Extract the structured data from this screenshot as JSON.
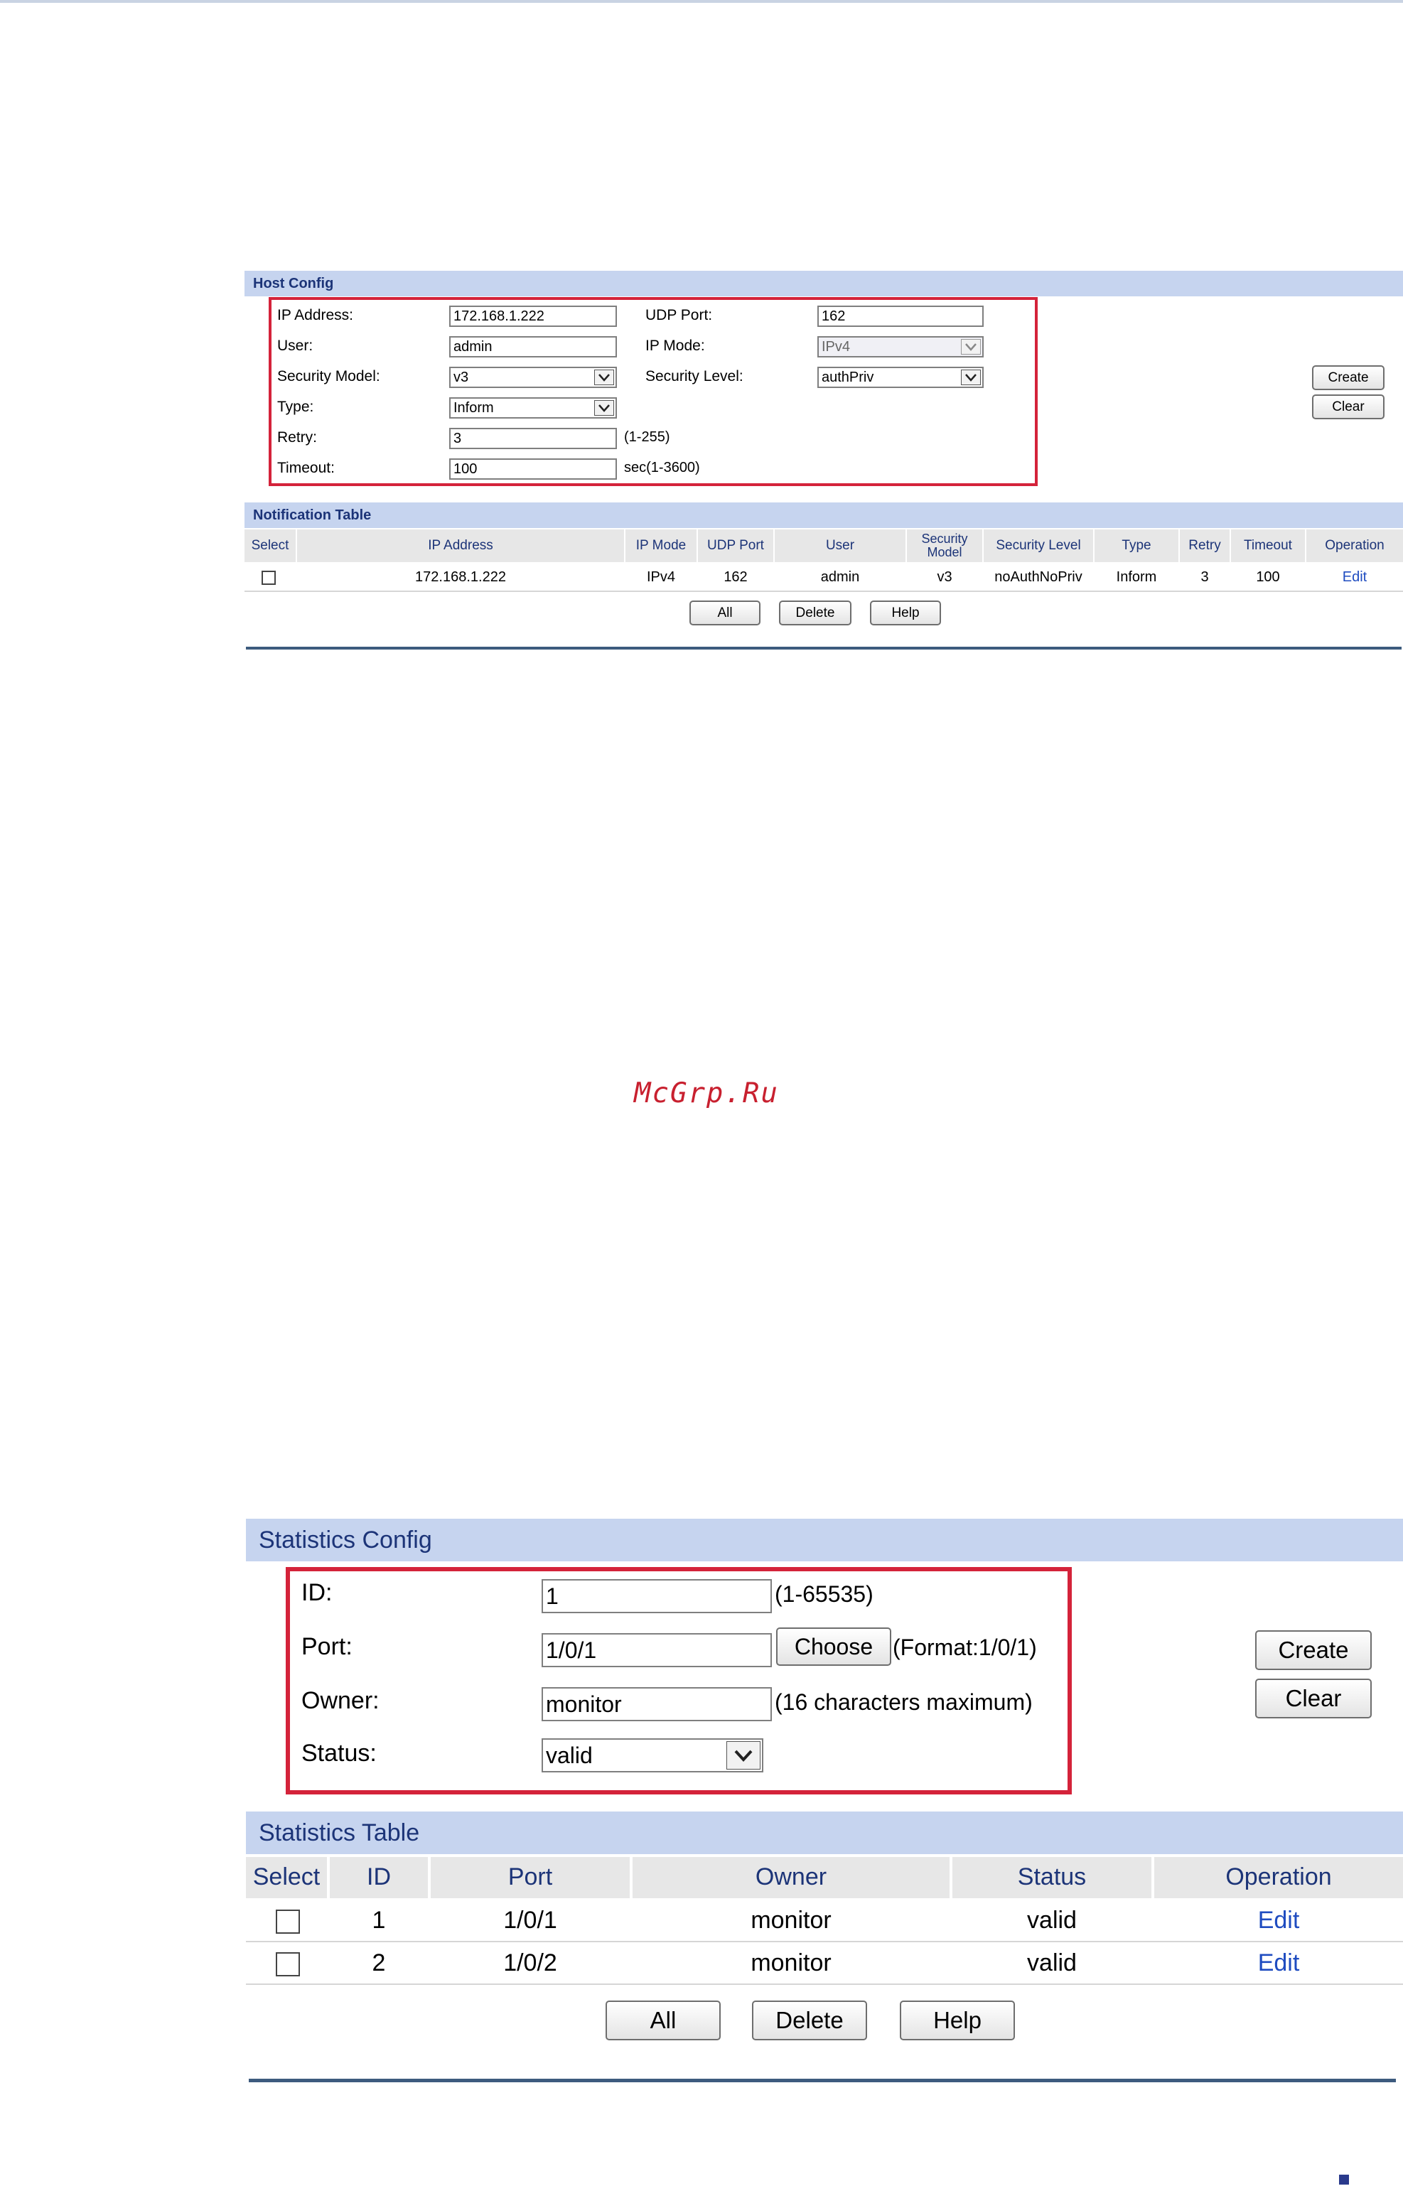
{
  "host_config": {
    "header": "Host Config",
    "fields": {
      "ip_address": {
        "label": "IP Address:",
        "value": "172.168.1.222"
      },
      "udp_port": {
        "label": "UDP Port:",
        "value": "162"
      },
      "user": {
        "label": "User:",
        "value": "admin"
      },
      "ip_mode": {
        "label": "IP Mode:",
        "value": "IPv4"
      },
      "security_model": {
        "label": "Security Model:",
        "value": "v3"
      },
      "security_level": {
        "label": "Security Level:",
        "value": "authPriv"
      },
      "type": {
        "label": "Type:",
        "value": "Inform"
      },
      "retry": {
        "label": "Retry:",
        "value": "3",
        "hint": "(1-255)"
      },
      "timeout": {
        "label": "Timeout:",
        "value": "100",
        "hint": "sec(1-3600)"
      }
    },
    "create_label": "Create",
    "clear_label": "Clear"
  },
  "notification_table": {
    "header": "Notification Table",
    "columns": [
      "Select",
      "IP Address",
      "IP Mode",
      "UDP Port",
      "User",
      "Security Model",
      "Security Level",
      "Type",
      "Retry",
      "Timeout",
      "Operation"
    ],
    "rows": [
      {
        "ip": "172.168.1.222",
        "ip_mode": "IPv4",
        "udp_port": "162",
        "user": "admin",
        "security_model": "v3",
        "security_level": "noAuthNoPriv",
        "type": "Inform",
        "retry": "3",
        "timeout": "100",
        "operation": "Edit"
      }
    ],
    "all_label": "All",
    "delete_label": "Delete",
    "help_label": "Help"
  },
  "watermark": "McGrp.Ru",
  "statistics_config": {
    "header": "Statistics Config",
    "fields": {
      "id": {
        "label": "ID:",
        "value": "1",
        "hint": "(1-65535)"
      },
      "port": {
        "label": "Port:",
        "value": "1/0/1",
        "button": "Choose",
        "hint": "(Format:1/0/1)"
      },
      "owner": {
        "label": "Owner:",
        "value": "monitor",
        "hint": "(16 characters maximum)"
      },
      "status": {
        "label": "Status:",
        "value": "valid"
      }
    },
    "create_label": "Create",
    "clear_label": "Clear"
  },
  "statistics_table": {
    "header": "Statistics Table",
    "columns": [
      "Select",
      "ID",
      "Port",
      "Owner",
      "Status",
      "Operation"
    ],
    "rows": [
      {
        "id": "1",
        "port": "1/0/1",
        "owner": "monitor",
        "status": "valid",
        "operation": "Edit"
      },
      {
        "id": "2",
        "port": "1/0/2",
        "owner": "monitor",
        "status": "valid",
        "operation": "Edit"
      }
    ],
    "all_label": "All",
    "delete_label": "Delete",
    "help_label": "Help"
  }
}
